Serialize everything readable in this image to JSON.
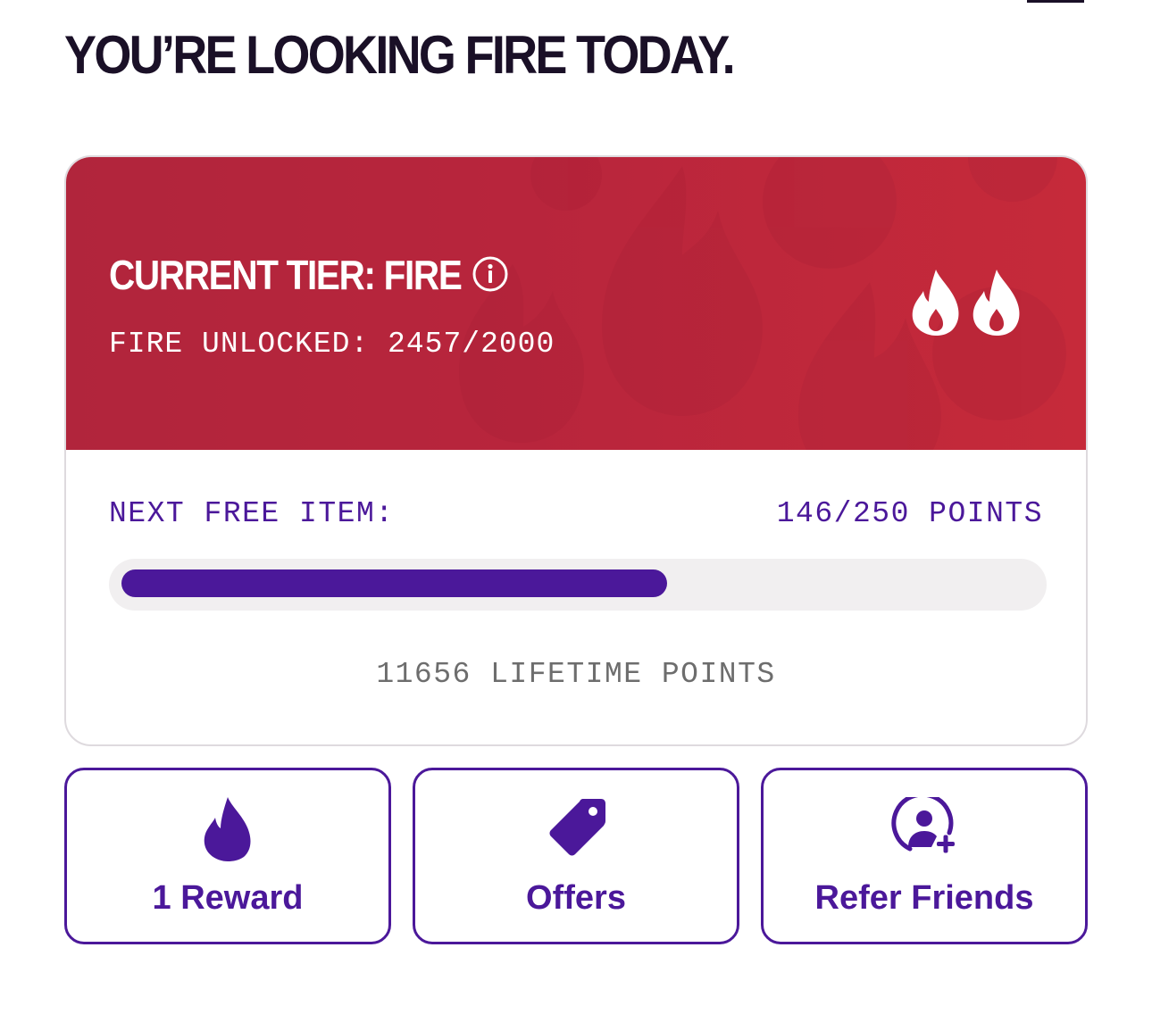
{
  "header": {
    "greeting": "YOU’RE LOOKING FIRE TODAY."
  },
  "tier_card": {
    "title": "CURRENT TIER: FIRE",
    "info_icon": "info-icon",
    "progress_text": "FIRE UNLOCKED: 2457/2000",
    "tier_icon": "double-flame-icon",
    "next_item_label": "NEXT FREE ITEM:",
    "next_item_value": "146/250 POINTS",
    "next_item_progress": {
      "current": 146,
      "goal": 250
    },
    "lifetime_points": "11656 LIFETIME POINTS"
  },
  "actions": [
    {
      "label": "1 Reward",
      "icon": "flame-icon"
    },
    {
      "label": "Offers",
      "icon": "tag-icon"
    },
    {
      "label": "Refer Friends",
      "icon": "add-friend-icon"
    }
  ],
  "colors": {
    "primary_purple": "#4b189a",
    "fire_red": "#b8253c",
    "heading_dark": "#1a1027",
    "muted_gray": "#6d6d6d"
  }
}
